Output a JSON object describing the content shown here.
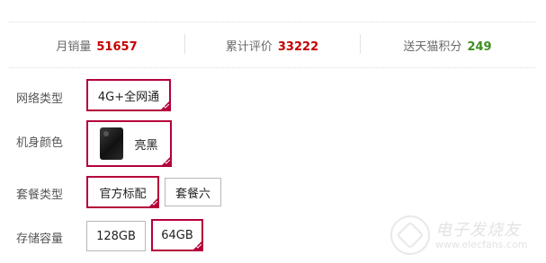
{
  "stats": {
    "monthly_sales": {
      "label": "月销量",
      "value": "51657"
    },
    "total_reviews": {
      "label": "累计评价",
      "value": "33222"
    },
    "tmall_points": {
      "label": "送天猫积分",
      "value": "249"
    }
  },
  "options": {
    "network": {
      "label": "网络类型",
      "choices": [
        "4G+全网通"
      ],
      "selected": "4G+全网通"
    },
    "color": {
      "label": "机身颜色",
      "choices": [
        "亮黑"
      ],
      "selected": "亮黑"
    },
    "bundle": {
      "label": "套餐类型",
      "choices": [
        "官方标配",
        "套餐六"
      ],
      "selected": "官方标配"
    },
    "storage": {
      "label": "存储容量",
      "choices": [
        "128GB",
        "64GB"
      ],
      "selected": "64GB"
    }
  },
  "watermark": {
    "name": "电子发烧友",
    "url": "www.elecfans.com"
  },
  "colors": {
    "accent": "#b4003a",
    "price_red": "#c40000",
    "points_green": "#3d8f1f"
  }
}
